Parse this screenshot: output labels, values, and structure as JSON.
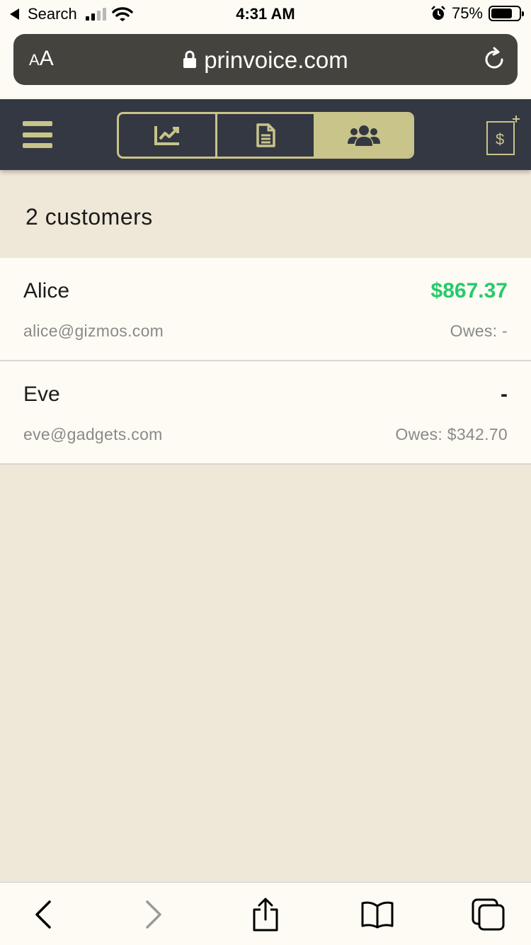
{
  "status_bar": {
    "back_app": "Search",
    "time": "4:31 AM",
    "battery_percent": "75%",
    "battery_level": 0.75
  },
  "browser": {
    "text_size_label_small": "A",
    "text_size_label_large": "A",
    "url": "prinvoice.com"
  },
  "app_header": {
    "tabs": [
      {
        "icon": "chart-icon",
        "active": false
      },
      {
        "icon": "document-icon",
        "active": false
      },
      {
        "icon": "users-icon",
        "active": true
      }
    ],
    "new_invoice_symbol": "$",
    "colors": {
      "header_bg": "#343842",
      "accent": "#c8c48a"
    }
  },
  "main": {
    "count_text": "2 customers",
    "customers": [
      {
        "name": "Alice",
        "email": "alice@gizmos.com",
        "paid": "$867.37",
        "owes": "Owes: -",
        "paid_color": "#27c96b"
      },
      {
        "name": "Eve",
        "email": "eve@gadgets.com",
        "paid": "-",
        "owes": "Owes: $342.70",
        "paid_color": "#1c1c1c"
      }
    ]
  },
  "toolbar": {
    "icons": [
      "back-icon",
      "forward-icon",
      "share-icon",
      "bookmarks-icon",
      "tabs-icon"
    ]
  }
}
